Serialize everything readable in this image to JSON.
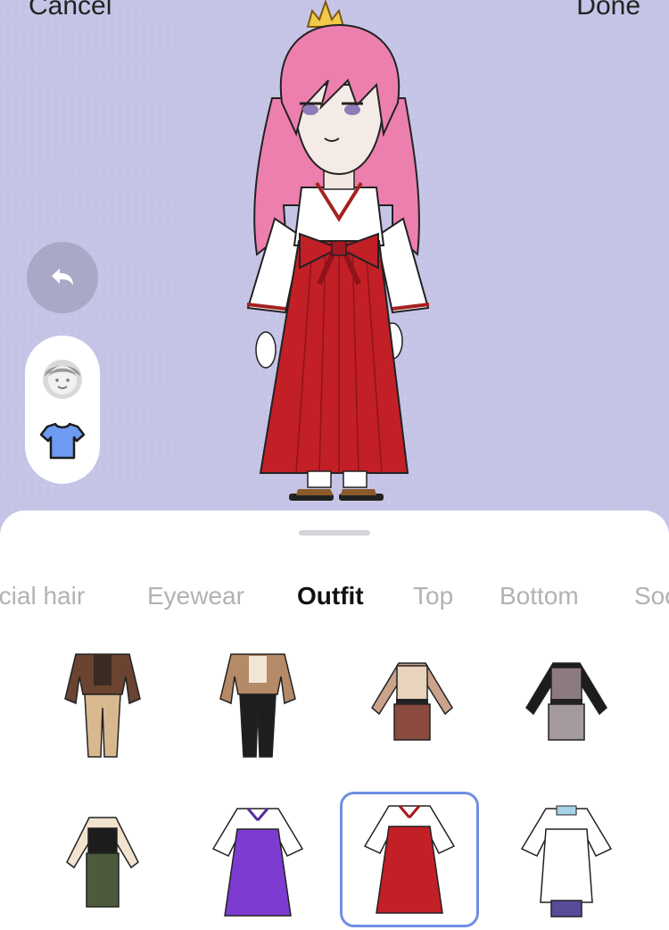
{
  "header": {
    "cancel_label": "Cancel",
    "done_label": "Done"
  },
  "side_controls": {
    "undo_icon": "undo-arrow-icon",
    "modes": [
      "face-icon",
      "shirt-icon"
    ],
    "active_mode": "shirt-icon"
  },
  "tabs": [
    {
      "label": "Facial hair"
    },
    {
      "label": "Eyewear"
    },
    {
      "label": "Outfit"
    },
    {
      "label": "Top"
    },
    {
      "label": "Bottom"
    },
    {
      "label": "Socks"
    }
  ],
  "active_tab": "Outfit",
  "outfits": {
    "selected_index": 6,
    "colors": {
      "background": "#c5c4e6",
      "selection": "#6f8fe3",
      "hakama_red": "#c31f27",
      "hair_pink": "#ec7fae"
    }
  }
}
